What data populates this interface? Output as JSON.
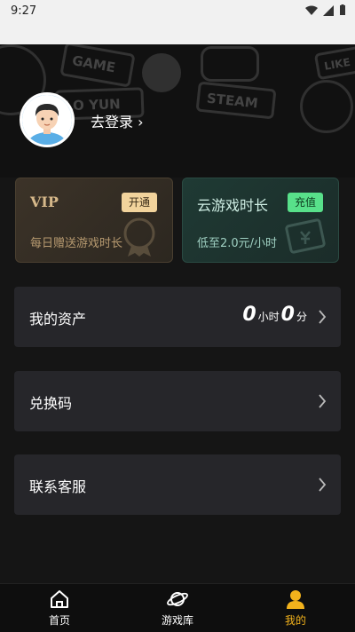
{
  "status_bar": {
    "time": "9:27"
  },
  "user": {
    "login_label": "去登录 ›"
  },
  "cards": {
    "vip": {
      "title": "VIP",
      "button": "开通",
      "subtitle": "每日赠送游戏时长"
    },
    "cloud": {
      "title": "云游戏时长",
      "button": "充值",
      "subtitle": "低至2.0元/小时"
    }
  },
  "menu": {
    "assets": {
      "label": "我的资产",
      "hours": "0",
      "hours_unit": "小时",
      "minutes": "0",
      "minutes_unit": "分"
    },
    "redeem": {
      "label": "兑换码"
    },
    "service": {
      "label": "联系客服"
    }
  },
  "nav": {
    "home": "首页",
    "library": "游戏库",
    "mine": "我的",
    "active_color": "#f2b21c"
  },
  "header_decor": {
    "game": "GAME",
    "steam": "STEAM",
    "yun": "LO YUN",
    "like": "LIKE"
  }
}
